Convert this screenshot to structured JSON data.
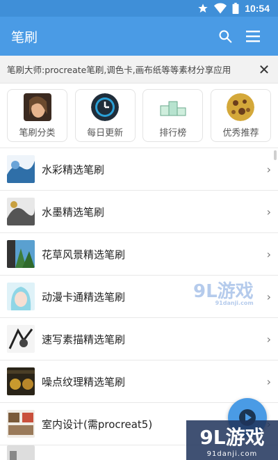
{
  "status_bar": {
    "time": "10:54"
  },
  "app_bar": {
    "title": "笔刷"
  },
  "notice": {
    "text": "笔刷大师:procreate笔刷,调色卡,画布纸等等素材分享应用",
    "close_symbol": "✕"
  },
  "quick_links": [
    {
      "label": "笔刷分类"
    },
    {
      "label": "每日更新"
    },
    {
      "label": "排行榜"
    },
    {
      "label": "优秀推荐"
    }
  ],
  "categories": [
    {
      "label": "水彩精选笔刷"
    },
    {
      "label": "水墨精选笔刷"
    },
    {
      "label": "花草风景精选笔刷"
    },
    {
      "label": "动漫卡通精选笔刷"
    },
    {
      "label": "速写素描精选笔刷"
    },
    {
      "label": "噪点纹理精选笔刷"
    },
    {
      "label": "室内设计(需procreat5)"
    }
  ],
  "chevron": "›",
  "watermark": {
    "logo_text": "9L游戏",
    "domain": "91danji.com"
  },
  "colors": {
    "primary": "#4a9be5",
    "status": "#3f8fd8"
  }
}
